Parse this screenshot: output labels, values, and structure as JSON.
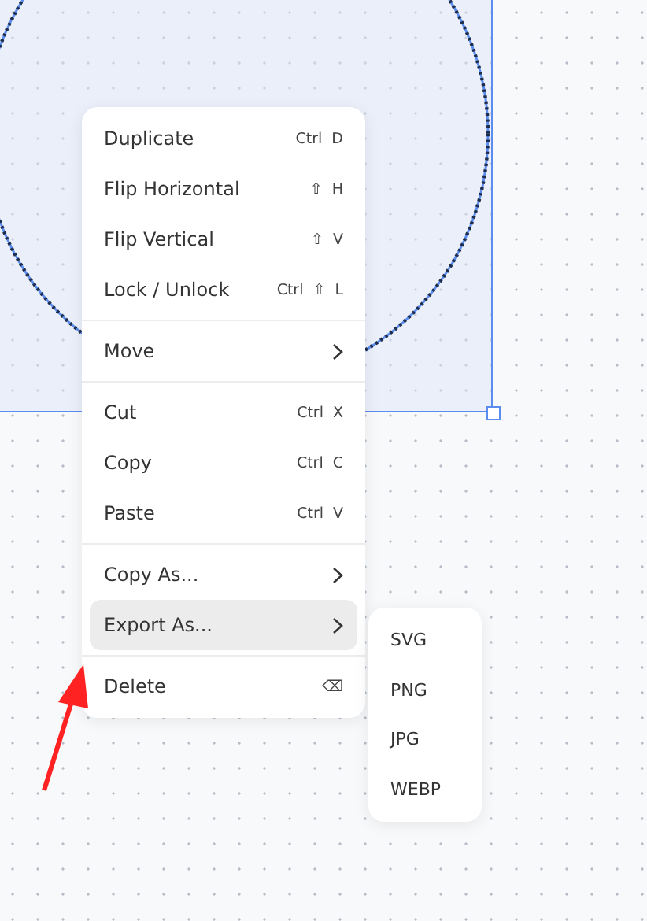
{
  "context_menu": {
    "sections": [
      [
        {
          "kind": "command",
          "label": "Duplicate",
          "shortcut": [
            "Ctrl",
            "D"
          ],
          "selected": false
        },
        {
          "kind": "command",
          "label": "Flip Horizontal",
          "shortcut": [
            "⇧",
            "H"
          ],
          "selected": false
        },
        {
          "kind": "command",
          "label": "Flip Vertical",
          "shortcut": [
            "⇧",
            "V"
          ],
          "selected": false
        },
        {
          "kind": "command",
          "label": "Lock / Unlock",
          "shortcut": [
            "Ctrl",
            "⇧",
            "L"
          ],
          "selected": false
        }
      ],
      [
        {
          "kind": "submenu",
          "label": "Move",
          "selected": false
        }
      ],
      [
        {
          "kind": "command",
          "label": "Cut",
          "shortcut": [
            "Ctrl",
            "X"
          ],
          "selected": false
        },
        {
          "kind": "command",
          "label": "Copy",
          "shortcut": [
            "Ctrl",
            "C"
          ],
          "selected": false
        },
        {
          "kind": "command",
          "label": "Paste",
          "shortcut": [
            "Ctrl",
            "V"
          ],
          "selected": false
        }
      ],
      [
        {
          "kind": "submenu",
          "label": "Copy As...",
          "selected": false
        },
        {
          "kind": "submenu",
          "label": "Export As...",
          "selected": true
        }
      ],
      [
        {
          "kind": "command",
          "label": "Delete",
          "shortcut": [
            "⌫"
          ],
          "selected": false
        }
      ]
    ]
  },
  "submenu": {
    "items": [
      {
        "label": "SVG"
      },
      {
        "label": "PNG"
      },
      {
        "label": "JPG"
      },
      {
        "label": "WEBP"
      }
    ]
  }
}
